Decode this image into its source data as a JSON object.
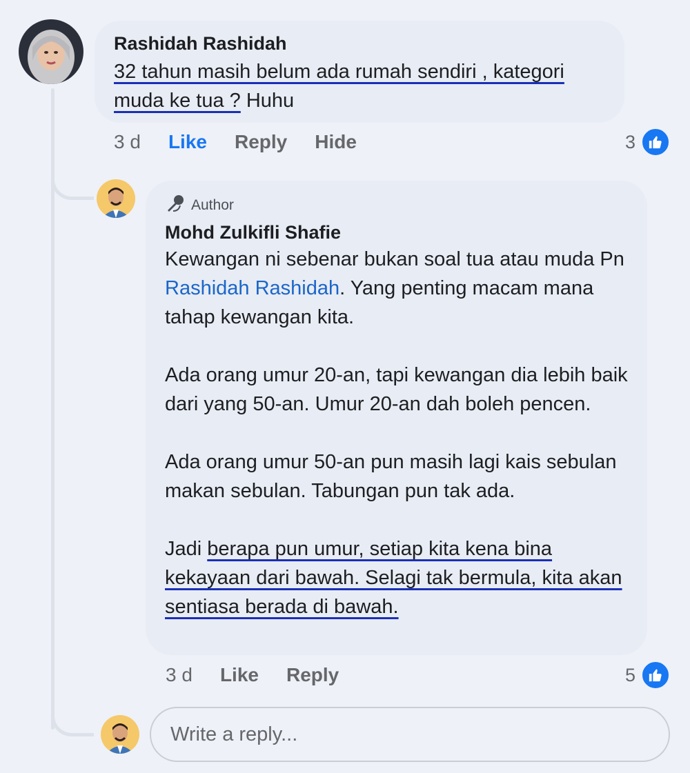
{
  "comment": {
    "author": "Rashidah Rashidah",
    "text_underlined": "32 tahun masih belum ada rumah sendiri , kategori muda ke tua ?",
    "text_plain": " Huhu",
    "time": "3 d",
    "like_label": "Like",
    "reply_label": "Reply",
    "hide_label": "Hide",
    "reaction_count": "3"
  },
  "reply": {
    "badge": "Author",
    "author": "Mohd Zulkifli Shafie",
    "p1_before": "Kewangan ni sebenar bukan soal tua atau muda Pn ",
    "p1_mention": "Rashidah Rashidah",
    "p1_after": ". Yang penting macam mana tahap kewangan kita.",
    "p2": "Ada orang umur 20-an, tapi kewangan dia lebih baik dari yang 50-an. Umur 20-an dah boleh pencen.",
    "p3": "Ada orang umur 50-an pun masih lagi kais sebulan makan sebulan. Tabungan pun tak ada.",
    "p4_before": "Jadi ",
    "p4_underlined": "berapa pun umur, setiap kita kena bina kekayaan dari bawah. Selagi tak bermula, kita akan sentiasa berada di bawah.",
    "time": "3 d",
    "like_label": "Like",
    "reply_label": "Reply",
    "reaction_count": "5"
  },
  "composer": {
    "placeholder": "Write a reply..."
  },
  "icons": {
    "author_badge": "microphone-icon",
    "reaction": "thumbs-up-icon"
  },
  "colors": {
    "like_active": "#1877f2",
    "mention": "#1a66c9",
    "underline": "#1a2fb5"
  }
}
